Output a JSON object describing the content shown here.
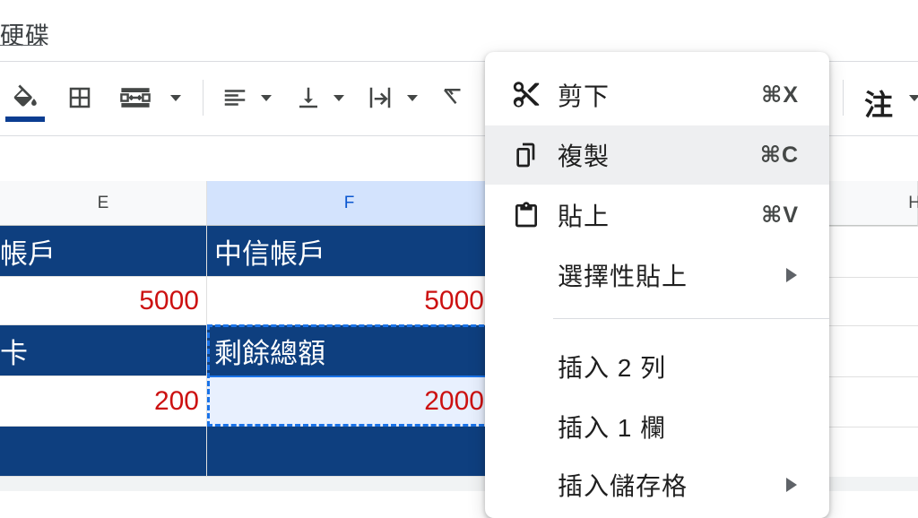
{
  "title": "硬碟",
  "toolbar": {
    "right_button": "注"
  },
  "columns": [
    {
      "label": "E",
      "selected": false
    },
    {
      "label": "F",
      "selected": true
    },
    {
      "label": "H",
      "selected": false
    }
  ],
  "rows": {
    "r1": {
      "e": "帳戶",
      "f": "中信帳戶"
    },
    "r2": {
      "e": "5000",
      "f": "5000"
    },
    "r3": {
      "e": "卡",
      "f": "剩餘總額"
    },
    "r4": {
      "e": "200",
      "f": "2000"
    }
  },
  "colors": {
    "header_fill": "#0e3f7f",
    "number_text": "#cc1111",
    "selection": "#1a73e8"
  },
  "context_menu": {
    "cut": {
      "label": "剪下",
      "shortcut": "⌘X",
      "icon": "scissors-icon"
    },
    "copy": {
      "label": "複製",
      "shortcut": "⌘C",
      "icon": "copy-icon"
    },
    "paste": {
      "label": "貼上",
      "shortcut": "⌘V",
      "icon": "clipboard-icon"
    },
    "paste_special": {
      "label": "選擇性貼上"
    },
    "insert_rows": {
      "label": "插入 2 列"
    },
    "insert_col": {
      "label": "插入 1 欄"
    },
    "insert_cells": {
      "label": "插入儲存格"
    }
  }
}
